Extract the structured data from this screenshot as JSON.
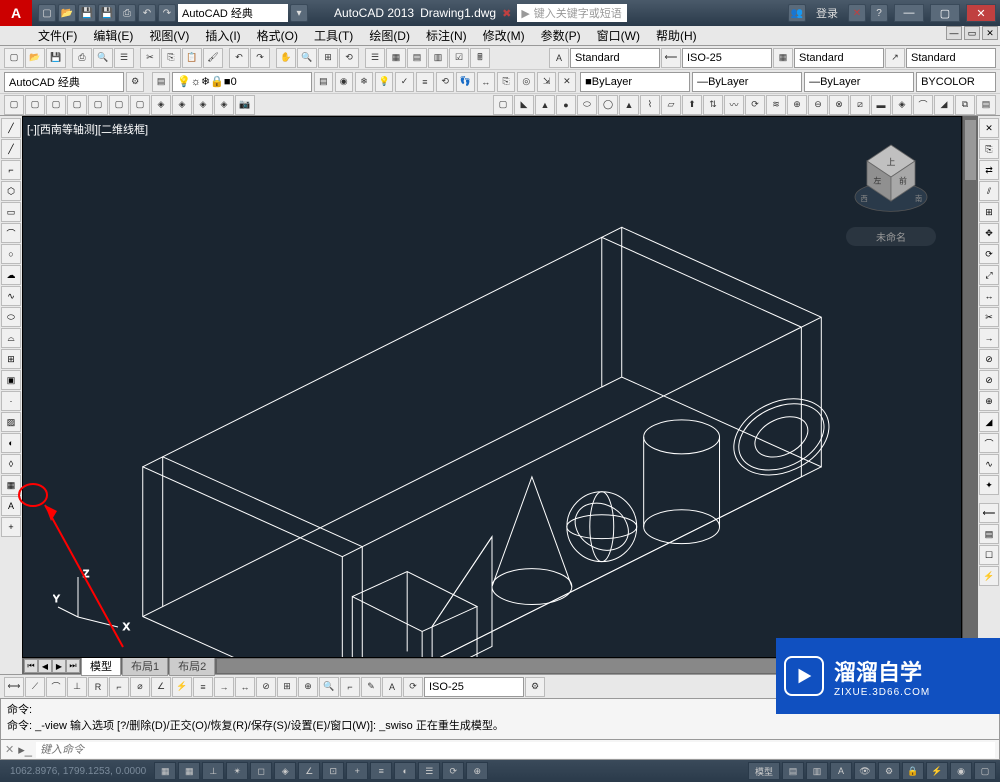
{
  "title": {
    "app_name": "AutoCAD 2013",
    "filename": "Drawing1.dwg",
    "search_placeholder": "键入关键字或短语",
    "login_label": "登录"
  },
  "workspace": {
    "current": "AutoCAD 经典"
  },
  "menu": {
    "items": [
      "文件(F)",
      "编辑(E)",
      "视图(V)",
      "插入(I)",
      "格式(O)",
      "工具(T)",
      "绘图(D)",
      "标注(N)",
      "修改(M)",
      "参数(P)",
      "窗口(W)",
      "帮助(H)"
    ]
  },
  "toolbar": {
    "style_dd1": "Standard",
    "style_dd2": "ISO-25",
    "style_dd3": "Standard",
    "style_dd4": "Standard"
  },
  "layer": {
    "workspace_dd": "AutoCAD 经典",
    "layer_name": "0",
    "color_bylayer": "ByLayer",
    "linetype_bylayer": "ByLayer",
    "lineweight_bylayer": "ByLayer",
    "plot_bycolor": "BYCOLOR"
  },
  "viewport": {
    "label": "[-][西南等轴测][二维线框]",
    "viewcube_badge": "未命名",
    "axis": {
      "x": "X",
      "y": "Y",
      "z": "Z"
    },
    "cube": {
      "top": "上",
      "left": "左",
      "front": "前",
      "west": "西",
      "south": "南"
    }
  },
  "tabs": {
    "model": "模型",
    "layout1": "布局1",
    "layout2": "布局2"
  },
  "dim_toolbar": {
    "style": "ISO-25"
  },
  "command": {
    "history_line1": "命令:",
    "history_line2": "命令: _-view 输入选项 [?/删除(D)/正交(O)/恢复(R)/保存(S)/设置(E)/窗口(W)]: _swiso 正在重生成模型。",
    "placeholder": "键入命令"
  },
  "status": {
    "coords": "1062.8976, 1799.1253, 0.0000",
    "model_label": "模型"
  },
  "watermark": {
    "title": "溜溜自学",
    "url": "ZIXUE.3D66.COM"
  }
}
